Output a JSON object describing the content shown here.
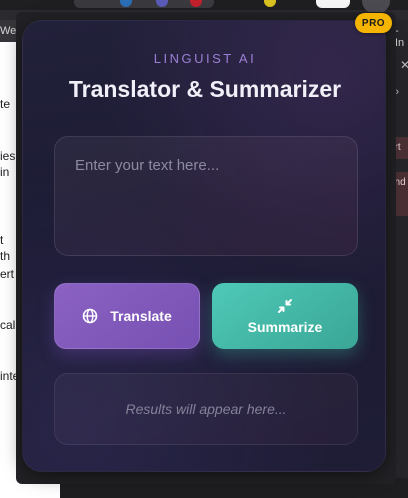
{
  "background": {
    "left_top_text": "We",
    "left_text_fragments": [
      "te",
      "ies",
      "in",
      "t",
      "th",
      "ert",
      "cal",
      "inte"
    ],
    "right_top_text": "- In",
    "right_fragments": [
      "ort",
      "und"
    ]
  },
  "popup": {
    "brand": "LINGUIST AI",
    "title": "Translator & Summarizer",
    "input_placeholder": "Enter your text here...",
    "translate_label": "Translate",
    "summarize_label": "Summarize",
    "results_placeholder": "Results will appear here...",
    "badge": "PRO"
  },
  "colors": {
    "brand": "#9b7fd6",
    "translate_button": "#8b62c4",
    "summarize_button": "#4fc9b8",
    "badge": "#f5b400"
  },
  "icons": {
    "translate": "globe-icon",
    "summarize": "compress-arrows-icon",
    "right_panel_toggle": "chevron-double-right-icon",
    "close": "close-icon"
  }
}
